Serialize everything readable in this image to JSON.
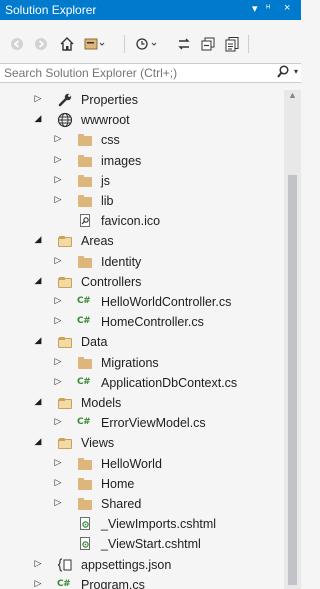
{
  "window": {
    "title": "Solution Explorer",
    "controls": {
      "dropdown": "▾",
      "pin": "ᵸ",
      "close": "×"
    }
  },
  "search": {
    "placeholder": "Search Solution Explorer (Ctrl+;)"
  },
  "tree": [
    {
      "label": "Properties",
      "icon": "wrench-icon",
      "arrow": "▷"
    },
    {
      "label": "wwwroot",
      "icon": "globe-icon",
      "arrow": "◢"
    },
    {
      "label": "css",
      "icon": "folder-icon",
      "arrow": "▷"
    },
    {
      "label": "images",
      "icon": "folder-icon",
      "arrow": "▷"
    },
    {
      "label": "js",
      "icon": "folder-icon",
      "arrow": "▷"
    },
    {
      "label": "lib",
      "icon": "folder-icon",
      "arrow": "▷"
    },
    {
      "label": "favicon.ico",
      "icon": "image-file-icon",
      "arrow": ""
    },
    {
      "label": "Areas",
      "icon": "folder-open-icon",
      "arrow": "◢"
    },
    {
      "label": "Identity",
      "icon": "folder-icon",
      "arrow": "▷"
    },
    {
      "label": "Controllers",
      "icon": "folder-open-icon",
      "arrow": "◢"
    },
    {
      "label": "HelloWorldController.cs",
      "icon": "csharp-file-icon",
      "arrow": "▷"
    },
    {
      "label": "HomeController.cs",
      "icon": "csharp-file-icon",
      "arrow": "▷"
    },
    {
      "label": "Data",
      "icon": "folder-open-icon",
      "arrow": "◢"
    },
    {
      "label": "Migrations",
      "icon": "folder-icon",
      "arrow": "▷"
    },
    {
      "label": "ApplicationDbContext.cs",
      "icon": "csharp-file-icon",
      "arrow": "▷"
    },
    {
      "label": "Models",
      "icon": "folder-open-icon",
      "arrow": "◢"
    },
    {
      "label": "ErrorViewModel.cs",
      "icon": "csharp-file-icon",
      "arrow": "▷"
    },
    {
      "label": "Views",
      "icon": "folder-open-icon",
      "arrow": "◢"
    },
    {
      "label": "HelloWorld",
      "icon": "folder-icon",
      "arrow": "▷"
    },
    {
      "label": "Home",
      "icon": "folder-icon",
      "arrow": "▷"
    },
    {
      "label": "Shared",
      "icon": "folder-icon",
      "arrow": "▷"
    },
    {
      "label": "_ViewImports.cshtml",
      "icon": "razor-file-icon",
      "arrow": ""
    },
    {
      "label": "_ViewStart.cshtml",
      "icon": "razor-file-icon",
      "arrow": ""
    },
    {
      "label": "appsettings.json",
      "icon": "json-file-icon",
      "arrow": "▷"
    },
    {
      "label": "Program.cs",
      "icon": "csharp-file-icon",
      "arrow": "▷"
    }
  ],
  "csharp_badge": "C#",
  "colors": {
    "title_bar": "#007acc",
    "folder": "#dcb67a",
    "csharp": "#368832"
  }
}
